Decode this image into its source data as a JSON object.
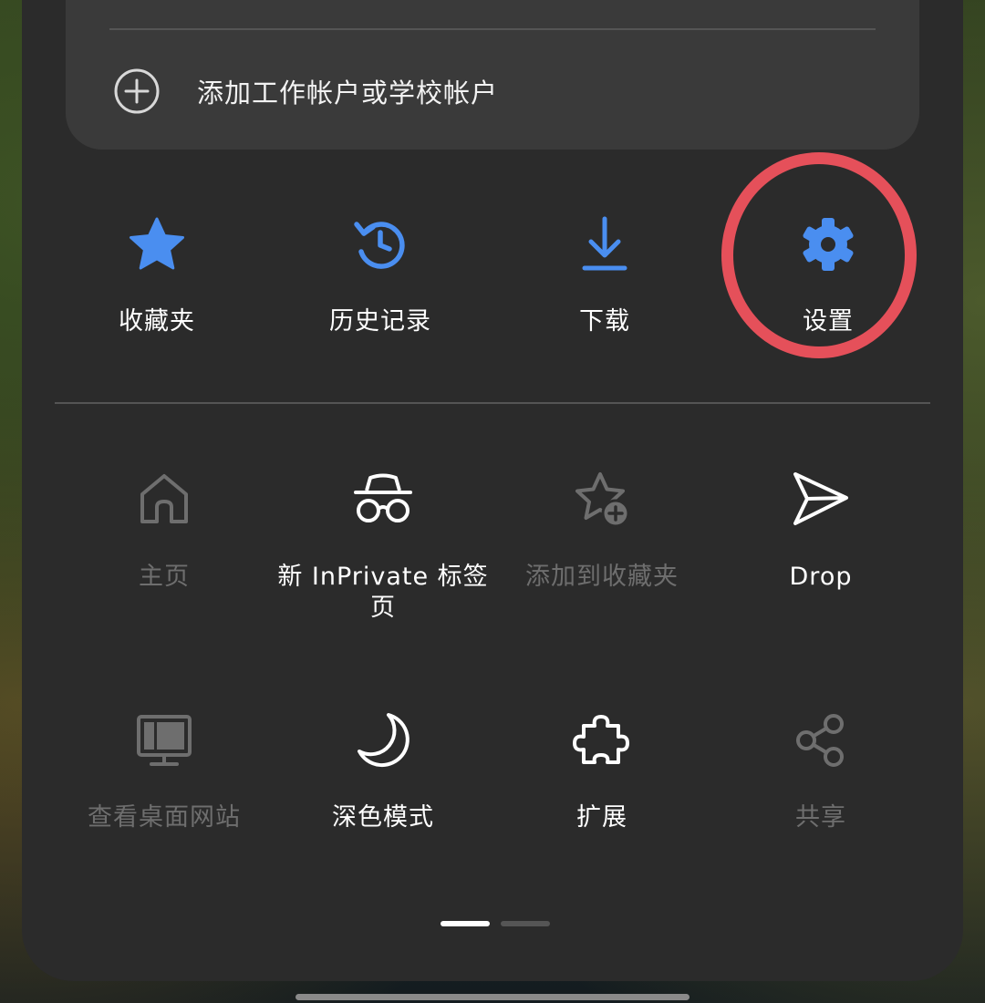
{
  "account": {
    "add_work_or_school_label": "添加工作帐户或学校帐户"
  },
  "quick_actions": [
    {
      "label": "收藏夹",
      "icon": "star-icon"
    },
    {
      "label": "历史记录",
      "icon": "history-icon"
    },
    {
      "label": "下载",
      "icon": "download-icon"
    },
    {
      "label": "设置",
      "icon": "gear-icon"
    }
  ],
  "menu_row_1": [
    {
      "label": "主页",
      "icon": "home-icon",
      "enabled": false
    },
    {
      "label": "新 InPrivate 标签页",
      "icon": "inprivate-icon",
      "enabled": true
    },
    {
      "label": "添加到收藏夹",
      "icon": "star-plus-icon",
      "enabled": false
    },
    {
      "label": "Drop",
      "icon": "send-icon",
      "enabled": true
    }
  ],
  "menu_row_2": [
    {
      "label": "查看桌面网站",
      "icon": "desktop-icon",
      "enabled": false
    },
    {
      "label": "深色模式",
      "icon": "moon-icon",
      "enabled": true
    },
    {
      "label": "扩展",
      "icon": "puzzle-icon",
      "enabled": true
    },
    {
      "label": "共享",
      "icon": "share-icon",
      "enabled": false
    }
  ],
  "pager": {
    "current_page": 1,
    "total_pages": 2
  },
  "colors": {
    "accent_blue": "#4a8ef0",
    "highlight_red": "#e5505a",
    "sheet_bg": "#2b2b2b",
    "card_bg": "#3a3a3a",
    "enabled_text": "#ffffff",
    "disabled_text": "#6e6e6e"
  }
}
